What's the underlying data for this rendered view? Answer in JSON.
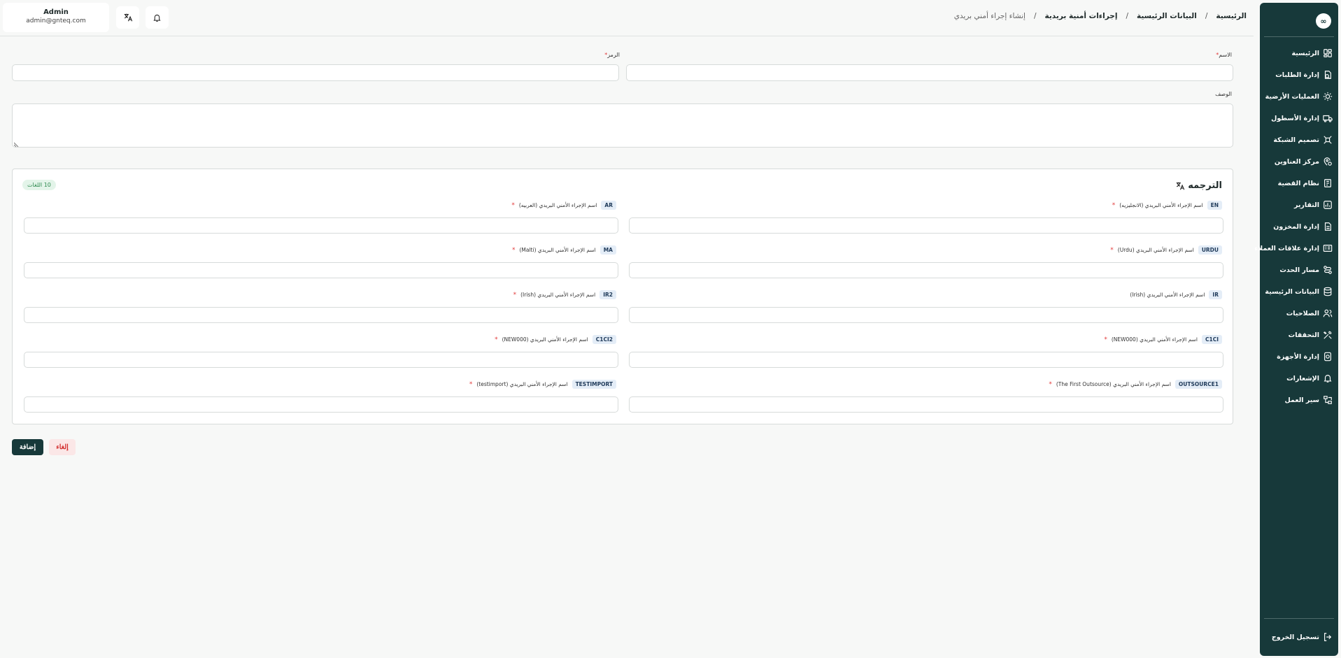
{
  "header": {
    "user_name": "Admin",
    "user_email": "admin@gnteq.com",
    "breadcrumbs": [
      "الرئيسية",
      "البيانات الرئيسية",
      "إجراءات أمنية بريدية",
      "إنشاء إجراء أمني بريدي"
    ],
    "separator": "/"
  },
  "sidebar": {
    "logo": "∞",
    "items": [
      {
        "label": "الرئيسية",
        "icon": "dashboard-icon"
      },
      {
        "label": "إدارة الطلبات",
        "icon": "orders-icon"
      },
      {
        "label": "العمليات الأرضية",
        "icon": "ground-ops-icon"
      },
      {
        "label": "إدارة الأسطول",
        "icon": "truck-icon"
      },
      {
        "label": "تصميم الشبكة",
        "icon": "network-icon"
      },
      {
        "label": "مركز العناوين",
        "icon": "address-icon"
      },
      {
        "label": "نظام القضية",
        "icon": "case-icon"
      },
      {
        "label": "التقارير",
        "icon": "reports-icon"
      },
      {
        "label": "إدارة المخزون",
        "icon": "inventory-icon"
      },
      {
        "label": "إدارة علاقات العملاء",
        "icon": "crm-icon"
      },
      {
        "label": "مسار الحدث",
        "icon": "event-path-icon"
      },
      {
        "label": "البيانات الرئيسية",
        "icon": "database-icon"
      },
      {
        "label": "الصلاحيات",
        "icon": "users-icon"
      },
      {
        "label": "التحققات",
        "icon": "tools-icon"
      },
      {
        "label": "إدارة الأجهزة",
        "icon": "device-icon"
      },
      {
        "label": "الإشعارات",
        "icon": "bell-icon"
      },
      {
        "label": "سير العمل",
        "icon": "workflow-icon"
      }
    ],
    "logout_label": "تسجيل الخروج"
  },
  "form": {
    "name_label": "الاسم",
    "code_label": "الرمز",
    "description_label": "الوصف",
    "required_mark": "*",
    "name_value": "",
    "code_value": "",
    "description_value": ""
  },
  "translation": {
    "title": "الترجمه",
    "languages_count": "10 اللغات",
    "required_mark": "*",
    "fields": [
      {
        "badge": "EN",
        "label": "اسم الإجراء الأمني البريدي (الانجليزيه)",
        "required": true
      },
      {
        "badge": "AR",
        "label": "اسم الإجراء الأمني البريدي (العربيه)",
        "required": true
      },
      {
        "badge": "URDU",
        "label": "اسم الإجراء الأمني البريدي (Urdu)",
        "required": true
      },
      {
        "badge": "MA",
        "label": "اسم الإجراء الأمني البريدي (Malti)",
        "required": true
      },
      {
        "badge": "IR",
        "label": "اسم الإجراء الأمني البريدي (Irish)",
        "required": false
      },
      {
        "badge": "IR2",
        "label": "اسم الإجراء الأمني البريدي (Irish)",
        "required": true
      },
      {
        "badge": "C1CI",
        "label": "اسم الإجراء الأمني البريدي (NEW000)",
        "required": true
      },
      {
        "badge": "C1CI2",
        "label": "اسم الإجراء الأمني البريدي (NEW000)",
        "required": true
      },
      {
        "badge": "OUTSOURCE1",
        "label": "اسم الإجراء الأمني البريدي (The First Outsource)",
        "required": true
      },
      {
        "badge": "TESTIMPORT",
        "label": "اسم الإجراء الأمني البريدي (testimport)",
        "required": true
      }
    ]
  },
  "actions": {
    "add_label": "إضافة",
    "cancel_label": "إلغاء"
  },
  "colors": {
    "sidebar_bg": "#17393a",
    "primary": "#17393a",
    "danger": "#d22b2b",
    "badge_bg": "#e4edf7",
    "success_bg": "#e3f4e9"
  }
}
